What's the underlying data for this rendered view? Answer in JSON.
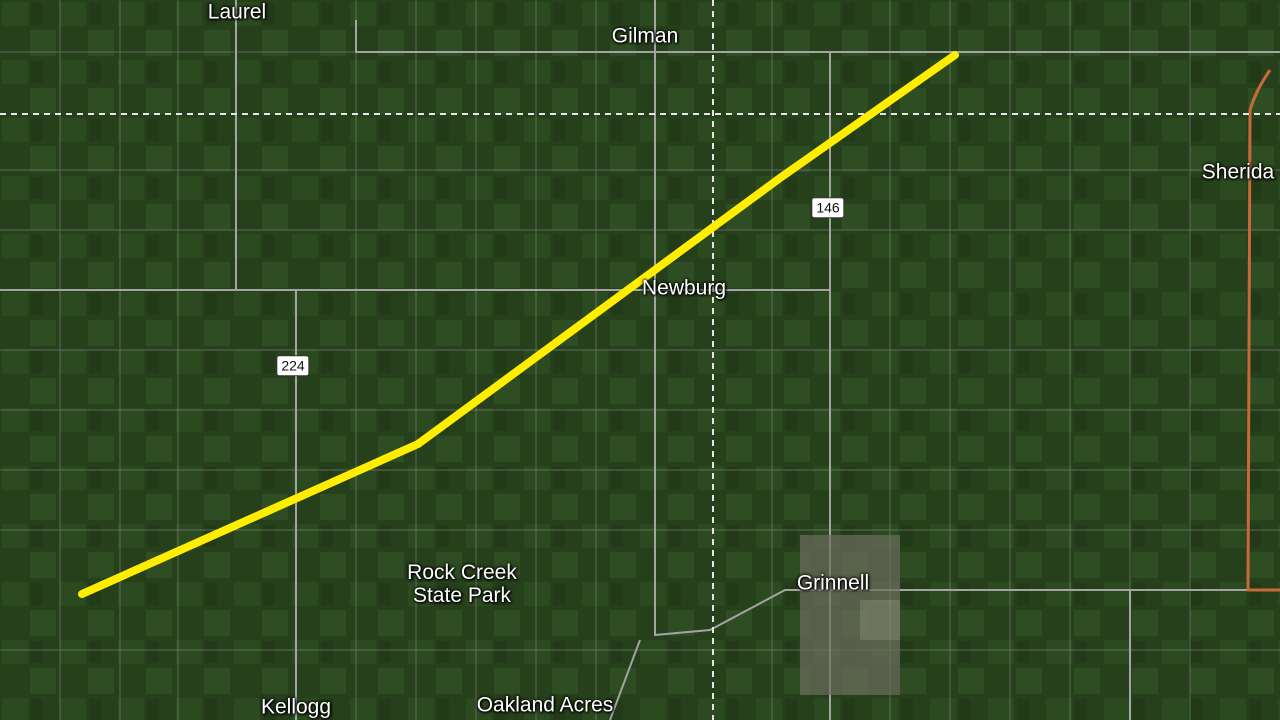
{
  "places": {
    "laurel": "Laurel",
    "gilman": "Gilman",
    "sheridan": "Sherida",
    "newburg": "Newburg",
    "rock_creek_line1": "Rock Creek",
    "rock_creek_line2": "State Park",
    "grinnell": "Grinnell",
    "kellogg": "Kellogg",
    "oakland_acres": "Oakland Acres"
  },
  "highway_shields": {
    "hwy_146": "146",
    "hwy_224": "224"
  },
  "colors": {
    "terrain": "#26401c",
    "field_light": "#3b5a26",
    "road": "#9a9a9a",
    "county_line": "#e6e6e6",
    "tornado_path": "#ffee00",
    "highway_orange": "#c76a3a"
  }
}
